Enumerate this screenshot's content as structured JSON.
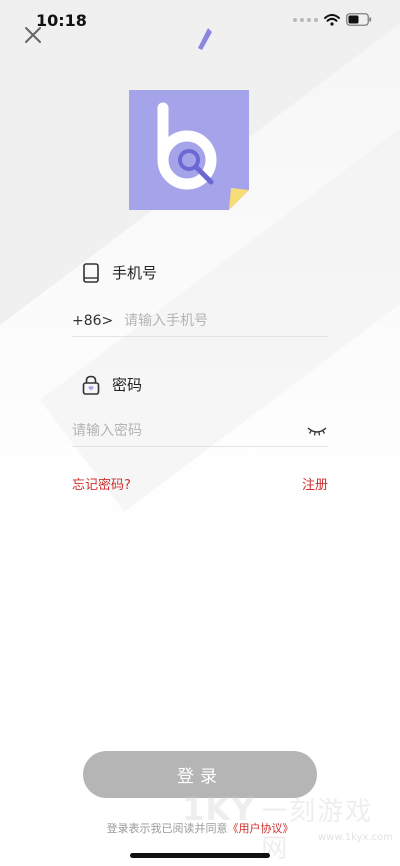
{
  "status_bar": {
    "time": "10:18"
  },
  "phone_field": {
    "label": "手机号",
    "country_code": "+86>",
    "placeholder": "请输入手机号",
    "value": ""
  },
  "password_field": {
    "label": "密码",
    "placeholder": "请输入密码",
    "value": ""
  },
  "links": {
    "forgot_password": "忘记密码?",
    "register": "注册"
  },
  "login_button": {
    "label": "登录"
  },
  "agreement": {
    "prefix": "登录表示我已阅读并同意",
    "link": "《用户协议》"
  },
  "watermark": {
    "logo": "1KY",
    "text": "一刻游戏网",
    "url": "www.1kyx.com"
  },
  "colors": {
    "accent_red": "#cf2f2f",
    "logo_purple": "#a5a3ea",
    "logo_corner": "#f7dd78",
    "button_gray": "#b5b5b5"
  },
  "icons": {
    "close": "close-icon",
    "phone": "phone-icon",
    "lock": "lock-icon",
    "eye_closed": "eye-closed-icon",
    "wifi": "wifi-icon",
    "battery": "battery-icon"
  }
}
